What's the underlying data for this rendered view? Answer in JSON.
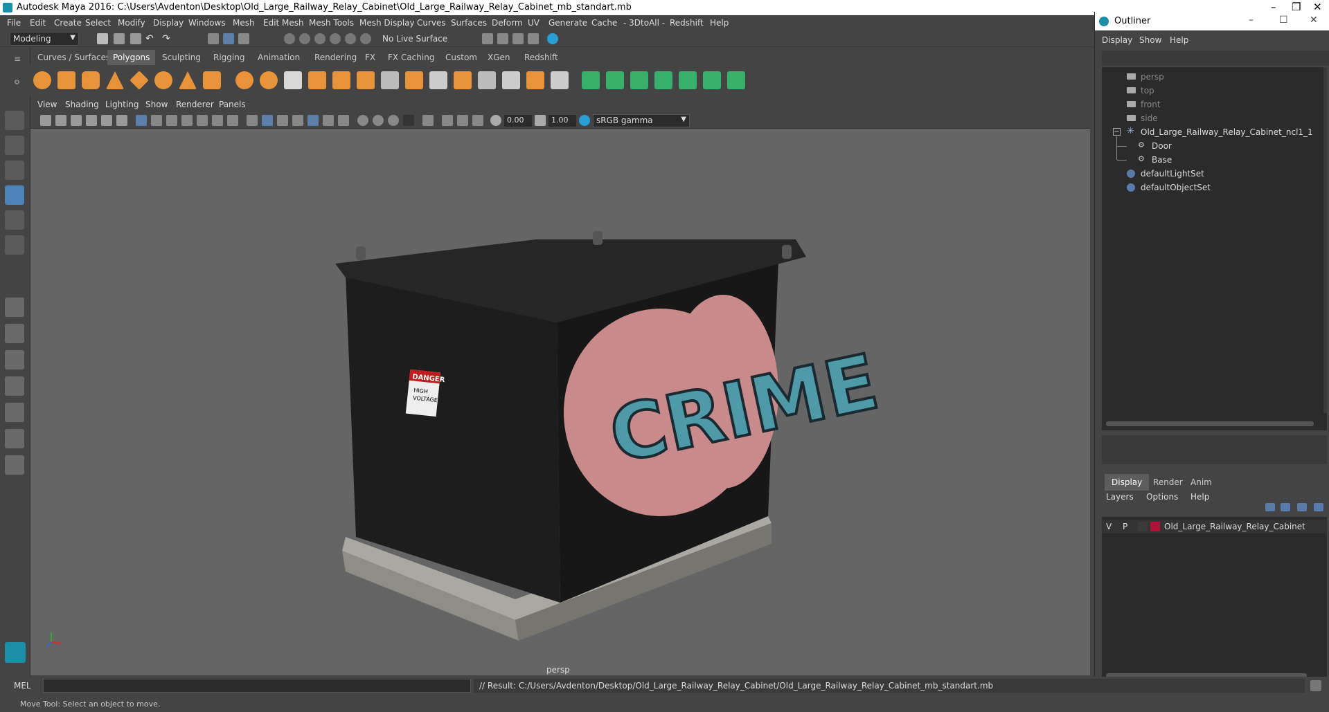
{
  "window": {
    "title": "Autodesk Maya 2016: C:\\Users\\Avdenton\\Desktop\\Old_Large_Railway_Relay_Cabinet\\Old_Large_Railway_Relay_Cabinet_mb_standart.mb",
    "controls": [
      "–",
      "❐",
      "✕"
    ]
  },
  "menubar": [
    "File",
    "Edit",
    "Create",
    "Select",
    "Modify",
    "Display",
    "Windows",
    "Mesh",
    "Edit Mesh",
    "Mesh Tools",
    "Mesh Display",
    "Curves",
    "Surfaces",
    "Deform",
    "UV",
    "Generate",
    "Cache",
    "- 3DtoAll -",
    "Redshift",
    "Help"
  ],
  "statusline": {
    "mode": "Modeling",
    "live_surface": "No Live Surface"
  },
  "shelf_tabs": [
    "Curves / Surfaces",
    "Polygons",
    "Sculpting",
    "Rigging",
    "Animation",
    "Rendering",
    "FX",
    "FX Caching",
    "Custom",
    "XGen",
    "Redshift"
  ],
  "shelf_active": "Polygons",
  "panel_menu": [
    "View",
    "Shading",
    "Lighting",
    "Show",
    "Renderer",
    "Panels"
  ],
  "panel_toolbar": {
    "exposure": "0.00",
    "gamma": "1.00",
    "color_space": "sRGB gamma"
  },
  "viewport": {
    "camera_label": "persp",
    "model_graffiti": "CRIME",
    "danger_sign": {
      "title": "DANGER",
      "line1": "HIGH",
      "line2": "VOLTAGE"
    }
  },
  "outliner": {
    "title": "Outliner",
    "controls": [
      "–",
      "☐",
      "✕"
    ],
    "menu": [
      "Display",
      "Show",
      "Help"
    ],
    "items": [
      {
        "label": "persp",
        "type": "camera",
        "indent": 0
      },
      {
        "label": "top",
        "type": "camera",
        "indent": 0
      },
      {
        "label": "front",
        "type": "camera",
        "indent": 0
      },
      {
        "label": "side",
        "type": "camera",
        "indent": 0
      },
      {
        "label": "Old_Large_Railway_Relay_Cabinet_ncl1_1",
        "type": "group",
        "indent": 0
      },
      {
        "label": "Door",
        "type": "mesh",
        "indent": 1
      },
      {
        "label": "Base",
        "type": "mesh",
        "indent": 1
      },
      {
        "label": "defaultLightSet",
        "type": "set",
        "indent": 0
      },
      {
        "label": "defaultObjectSet",
        "type": "set",
        "indent": 0
      }
    ]
  },
  "layer_editor": {
    "tabs": [
      "Display",
      "Render",
      "Anim"
    ],
    "active_tab": "Display",
    "menu": [
      "Layers",
      "Options",
      "Help"
    ],
    "layers": [
      {
        "v": "V",
        "p": "P",
        "color": "#b0103a",
        "name": "Old_Large_Railway_Relay_Cabinet"
      }
    ]
  },
  "command_line": {
    "language": "MEL",
    "result": "// Result: C:/Users/Avdenton/Desktop/Old_Large_Railway_Relay_Cabinet/Old_Large_Railway_Relay_Cabinet_mb_standart.mb"
  },
  "help_line": "Move Tool: Select an object to move."
}
